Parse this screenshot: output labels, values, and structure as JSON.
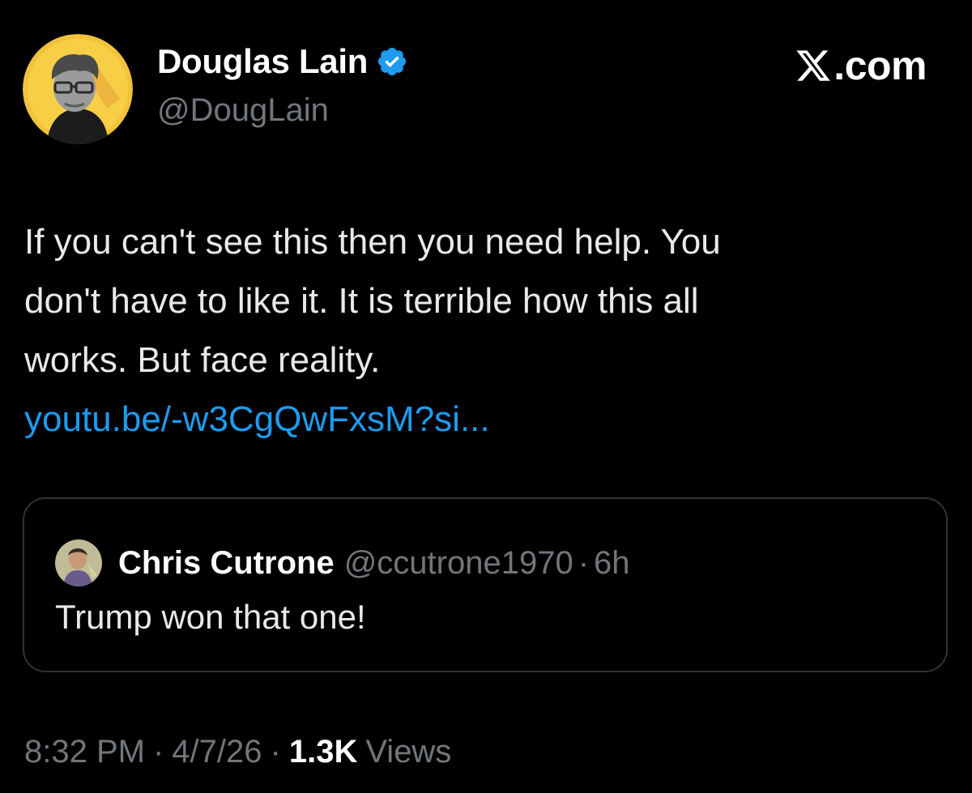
{
  "author": {
    "display_name": "Douglas Lain",
    "handle": "@DougLain",
    "verified_icon": "verified-badge-icon",
    "avatar_icon": "avatar-portrait"
  },
  "brand": {
    "label": ".com",
    "logo_icon": "x-logo-icon"
  },
  "tweet": {
    "lines": [
      "If you can't see this then you need help. You",
      "don't have to like it. It is terrible how this all",
      "works. But face reality."
    ],
    "link": "youtu.be/-w3CgQwFxsM?si..."
  },
  "quoted": {
    "display_name": "Chris Cutrone",
    "handle": "@ccutrone1970",
    "separator": "·",
    "time": "6h",
    "text": "Trump won that one!",
    "avatar_icon": "avatar-portrait"
  },
  "meta": {
    "time": "8:32 PM",
    "separator": "·",
    "date": "4/7/26",
    "views_count": "1.3K",
    "views_label": "Views"
  },
  "colors": {
    "background": "#000000",
    "text": "#e7e9ea",
    "muted": "#71767b",
    "link": "#1d9bf0",
    "verified": "#1d9bf0",
    "avatar_ring": "#f5c518",
    "border": "#2f3336"
  }
}
